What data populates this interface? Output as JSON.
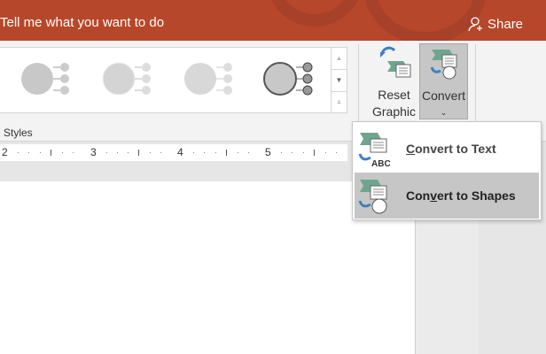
{
  "titlebar": {
    "tell_me": "Tell me what you want to do",
    "share": "Share"
  },
  "ribbon": {
    "reset_graphic_line1": "Reset",
    "reset_graphic_line2": "Graphic",
    "convert": "Convert",
    "styles_group": "Styles"
  },
  "ruler": [
    "2",
    "3",
    "4",
    "5"
  ],
  "menu": {
    "items": [
      {
        "label": "Convert to Text",
        "accel": "C"
      },
      {
        "label": "Convert to Shapes",
        "accel": "v"
      }
    ]
  },
  "colors": {
    "title_bg": "#b7472a",
    "highlight": "#c6c6c6",
    "green": "#6fa58f",
    "blue": "#3f7fc1"
  }
}
